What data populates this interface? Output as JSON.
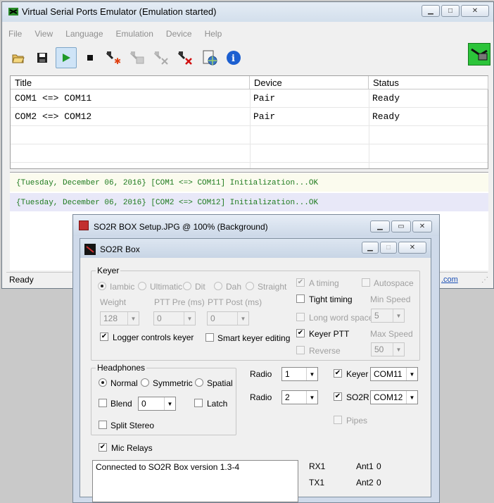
{
  "main": {
    "title": "Virtual Serial Ports Emulator (Emulation started)",
    "menu": [
      "File",
      "View",
      "Language",
      "Emulation",
      "Device",
      "Help"
    ],
    "columns": [
      "Title",
      "Device",
      "Status"
    ],
    "rows": [
      {
        "title": "COM1 <=> COM11",
        "device": "Pair",
        "status": "Ready"
      },
      {
        "title": "COM2 <=> COM12",
        "device": "Pair",
        "status": "Ready"
      }
    ],
    "log": [
      "{Tuesday, December 06, 2016} [COM1 <=> COM11] Initialization...OK",
      "{Tuesday, December 06, 2016} [COM2 <=> COM12] Initialization...OK"
    ],
    "status": "Ready",
    "status_link": ".com",
    "toolbar": [
      "open-icon",
      "save-icon",
      "start-icon",
      "stop-icon",
      "create-device-icon",
      "edit-device-icon",
      "delete-device-icon",
      "remove-device-icon",
      "network-icon",
      "info-icon"
    ]
  },
  "viewer": {
    "title": "SO2R BOX Setup.JPG @ 100% (Background)"
  },
  "so2r": {
    "title": "SO2R Box",
    "keyer": {
      "group": "Keyer",
      "modes": [
        "Iambic",
        "Ultimatic",
        "Dit",
        "Dah",
        "Straight"
      ],
      "weight_label": "Weight",
      "weight": "128",
      "ptt_pre_label": "PTT Pre (ms)",
      "ptt_pre": "0",
      "ptt_post_label": "PTT Post (ms)",
      "ptt_post": "0",
      "logger_controls": "Logger controls keyer",
      "smart_editing": "Smart keyer editing",
      "a_timing": "A timing",
      "autospace": "Autospace",
      "tight_timing": "Tight timing",
      "min_speed_label": "Min Speed",
      "long_word_space": "Long word space",
      "min_speed": "5",
      "keyer_ptt": "Keyer PTT",
      "max_speed_label": "Max Speed",
      "reverse": "Reverse",
      "max_speed": "50"
    },
    "headphones": {
      "group": "Headphones",
      "modes": [
        "Normal",
        "Symmetric",
        "Spatial"
      ],
      "blend": "Blend",
      "blend_value": "0",
      "latch": "Latch",
      "split_stereo": "Split Stereo"
    },
    "radio1_label": "Radio",
    "radio1": "1",
    "radio2_label": "Radio",
    "radio2": "2",
    "keyer_label": "Keyer",
    "keyer_port": "COM11",
    "so2r_label": "SO2R",
    "so2r_port": "COM12",
    "pipes": "Pipes",
    "mic_relays": "Mic Relays",
    "log_text": "Connected to SO2R Box version 1.3-4",
    "rx1": "RX1",
    "tx1": "TX1",
    "ant1": "Ant1",
    "ant1_value": "0",
    "ant2": "Ant2",
    "ant2_value": "0"
  }
}
